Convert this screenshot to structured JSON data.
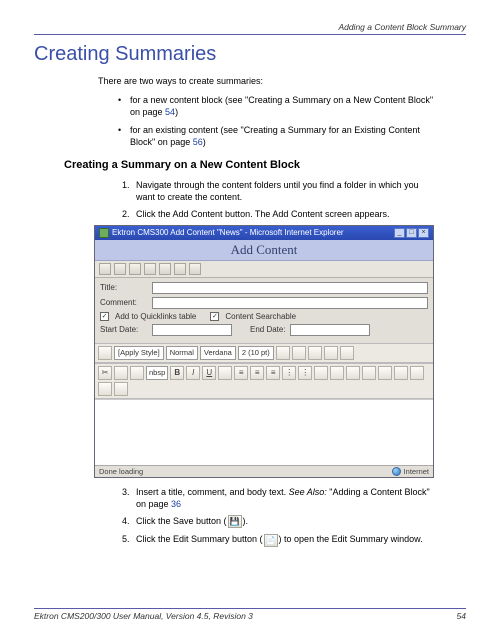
{
  "header": {
    "path": "Adding a Content Block Summary"
  },
  "title": "Creating Summaries",
  "intro": "There are two ways to create summaries:",
  "bullets": [
    {
      "text": "for a new content block (see \"Creating a Summary on a New Content Block\" on page ",
      "page": "54",
      "tail": ")"
    },
    {
      "text": "for an existing content (see \"Creating a Summary for an Existing Content Block\" on page ",
      "page": "56",
      "tail": ")"
    }
  ],
  "section": "Creating a Summary on a New Content Block",
  "steps_a": [
    "Navigate through the content folders until you find a folder in which you want to create the content.",
    "Click the Add Content button. The Add Content screen appears."
  ],
  "screenshot": {
    "window_title": "Ektron CMS300 Add Content \"News\" - Microsoft Internet Explorer",
    "banner": "Add Content",
    "form": {
      "title_label": "Title:",
      "comment_label": "Comment:",
      "quicklinks_label": "Add to Quicklinks table",
      "searchable_label": "Content Searchable",
      "start_label": "Start Date:",
      "end_label": "End Date:"
    },
    "toolbar": {
      "apply_style": "[Apply Style]",
      "format": "Normal",
      "font": "Verdana",
      "size": "2 (10 pt)",
      "nbsp": "nbsp"
    },
    "status": {
      "left": "Done loading",
      "right": "Internet"
    }
  },
  "steps_b": [
    {
      "pre": "Insert a title, comment, and body text. ",
      "em": "See Also:",
      "post": " \"Adding a Content Block\" on page ",
      "page": "36"
    },
    {
      "pre": "Click the Save button (",
      "post": ")."
    },
    {
      "pre": "Click the Edit Summary button (",
      "post": ") to open the Edit Summary window."
    }
  ],
  "footer": {
    "text": "Ektron CMS200/300 User Manual, Version 4.5, Revision 3",
    "page": "54"
  }
}
